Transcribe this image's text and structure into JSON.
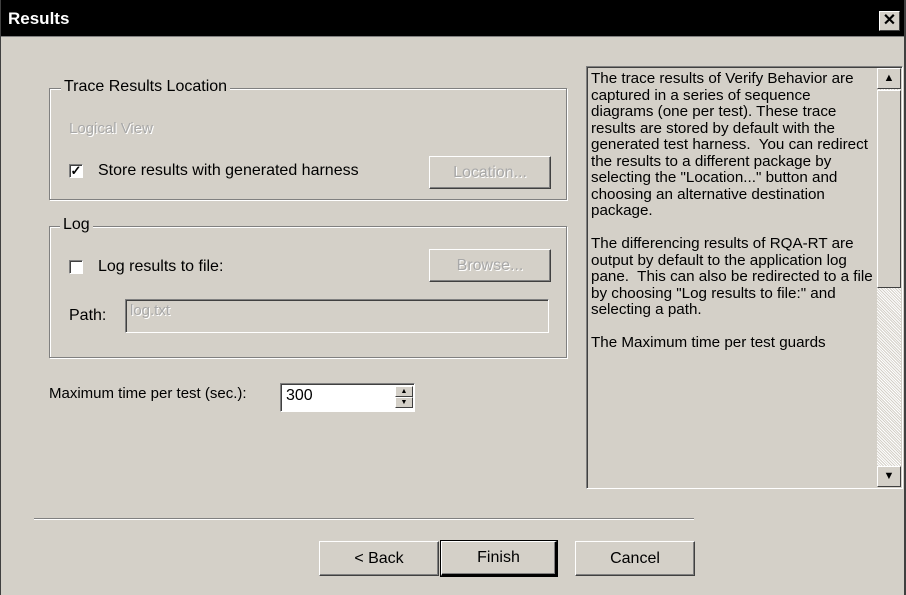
{
  "window": {
    "title": "Results",
    "close_glyph": "✕"
  },
  "trace": {
    "group_label": "Trace Results Location",
    "logical_view_label": "Logical View",
    "store_checkbox_checked": true,
    "store_label": "Store results with generated harness",
    "location_button": "Location..."
  },
  "log": {
    "group_label": "Log",
    "log_checkbox_checked": false,
    "log_label": "Log results to file:",
    "browse_button": "Browse...",
    "path_label": "Path:",
    "path_value": "log.txt"
  },
  "max_time": {
    "label": "Maximum time per test (sec.):",
    "value": "300"
  },
  "help_text": "The trace results of Verify Behavior are captured in a series of sequence diagrams (one per test). These trace results are stored by default with the generated test harness.  You can redirect the results to a different package by selecting the \"Location...\" button and choosing an alternative destination package.\n\nThe differencing results of RQA-RT are output by default to the application log pane.  This can also be redirected to a file by choosing \"Log results to file:\" and selecting a path.\n\nThe Maximum time per test guards",
  "footer": {
    "back_button": "< Back",
    "finish_button": "Finish",
    "cancel_button": "Cancel"
  }
}
